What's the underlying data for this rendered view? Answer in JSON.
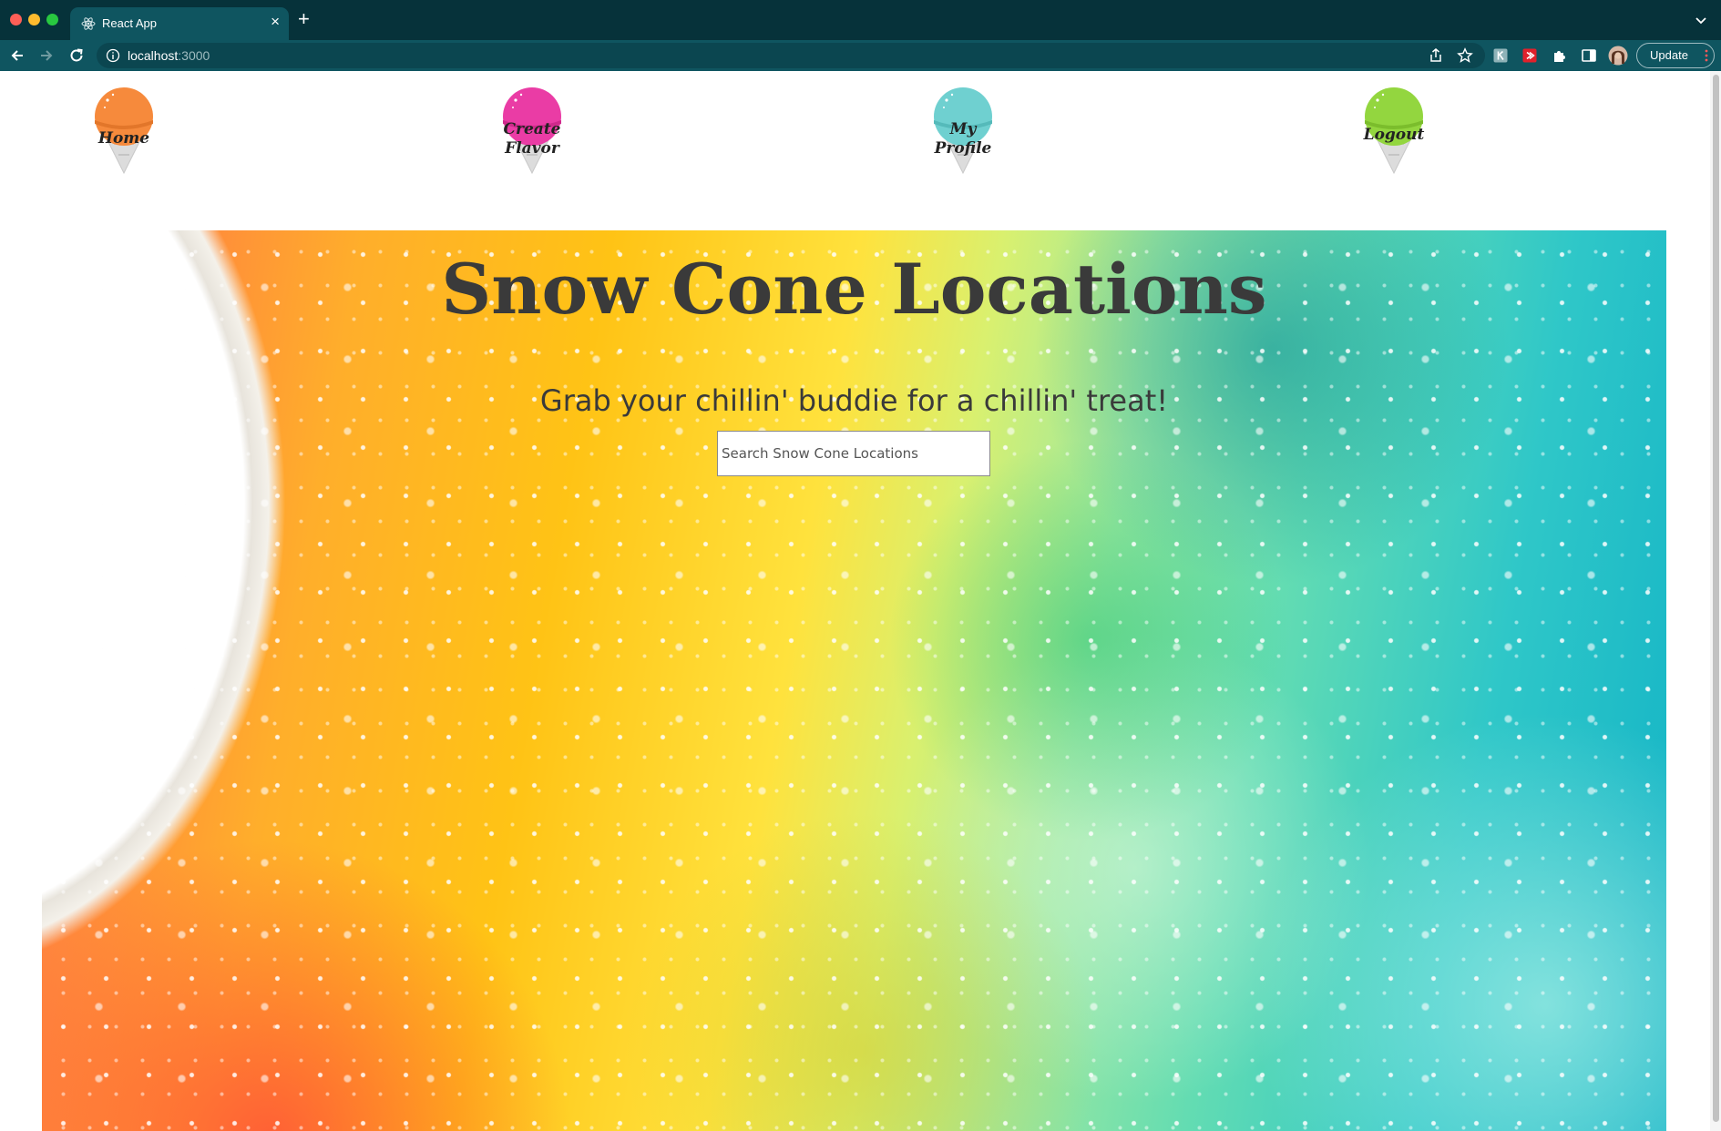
{
  "browser": {
    "tab_title": "React App",
    "url_host": "localhost",
    "url_port": ":3000",
    "update_label": "Update"
  },
  "nav": {
    "items": [
      {
        "label_line1": "Home",
        "label_line2": "",
        "scoop_color": "#f68a3c"
      },
      {
        "label_line1": "Create",
        "label_line2": "Flavor",
        "scoop_color": "#ea3ca5"
      },
      {
        "label_line1": "My",
        "label_line2": "Profile",
        "scoop_color": "#6fd0d0"
      },
      {
        "label_line1": "Logout",
        "label_line2": "",
        "scoop_color": "#93d63f"
      }
    ]
  },
  "hero": {
    "title": "Snow Cone Locations",
    "subtitle": "Grab your chillin' buddie for a chillin' treat!",
    "search_placeholder": "Search Snow Cone Locations"
  }
}
